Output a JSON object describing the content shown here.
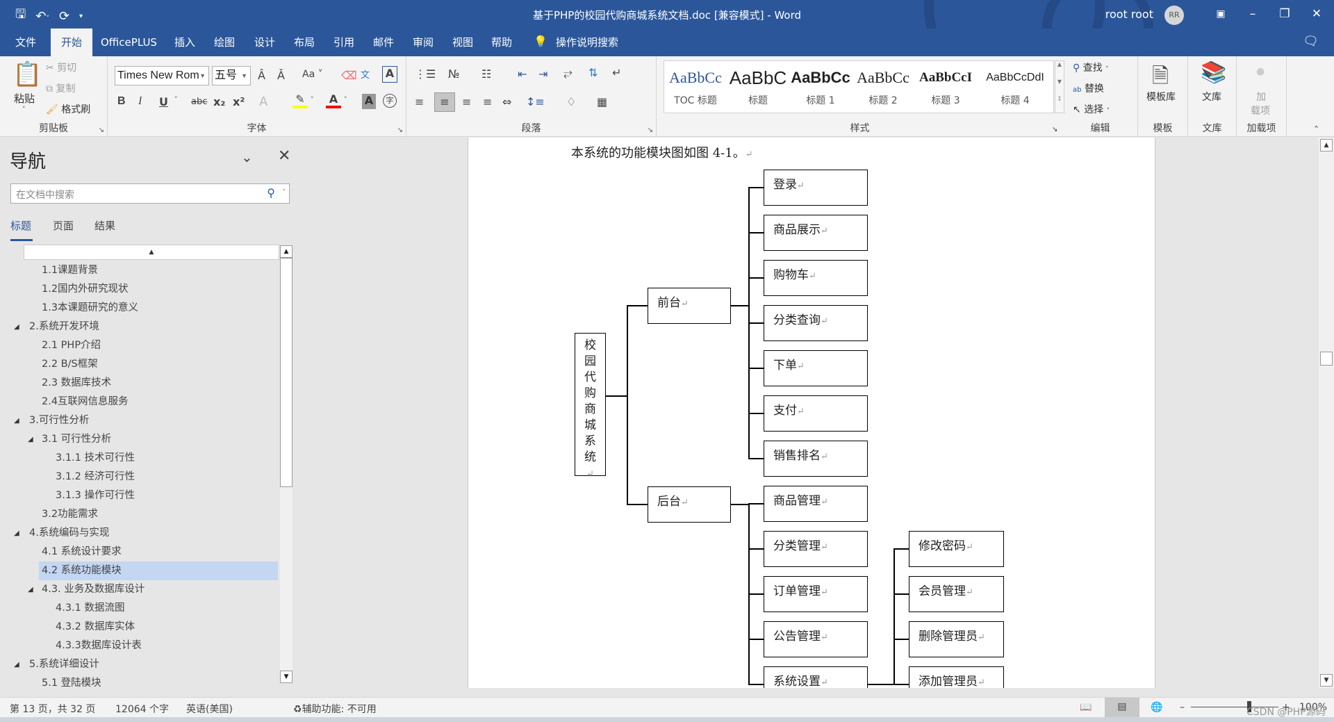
{
  "window": {
    "title": "基于PHP的校园代购商城系统文档.doc [兼容模式] - Word",
    "user_name": "root root",
    "user_initials": "RR",
    "quick_access": [
      "save-icon",
      "undo-icon",
      "redo-icon",
      "customize-qat-icon"
    ]
  },
  "tabs": [
    {
      "label": "文件",
      "active": false
    },
    {
      "label": "开始",
      "active": true
    },
    {
      "label": "OfficePLUS",
      "active": false
    },
    {
      "label": "插入",
      "active": false
    },
    {
      "label": "绘图",
      "active": false
    },
    {
      "label": "设计",
      "active": false
    },
    {
      "label": "布局",
      "active": false
    },
    {
      "label": "引用",
      "active": false
    },
    {
      "label": "邮件",
      "active": false
    },
    {
      "label": "审阅",
      "active": false
    },
    {
      "label": "视图",
      "active": false
    },
    {
      "label": "帮助",
      "active": false
    }
  ],
  "tell_me": "操作说明搜索",
  "ribbon": {
    "clipboard": {
      "label": "剪贴板",
      "paste": "粘贴",
      "cut": "剪切",
      "copy": "复制",
      "format_painter": "格式刷"
    },
    "font": {
      "label": "字体",
      "font_name": "Times New Rom",
      "font_size": "五号",
      "change_case": "Aa",
      "bold": "B",
      "italic": "I",
      "underline": "U",
      "strike": "abc",
      "subscript": "x₂",
      "superscript": "x²",
      "highlight_color": "#ffff00",
      "font_color": "#ff0000"
    },
    "paragraph": {
      "label": "段落"
    },
    "styles": {
      "label": "样式",
      "items": [
        {
          "preview": "AaBbCc",
          "name": "TOC 标题",
          "color": "#2f5597"
        },
        {
          "preview": "AaBbC",
          "name": "标题",
          "color": "#222"
        },
        {
          "preview": "AaBbCc",
          "name": "标题 1",
          "color": "#000"
        },
        {
          "preview": "AaBbCc",
          "name": "标题 2",
          "color": "#222"
        },
        {
          "preview": "AaBbCcI",
          "name": "标题 3",
          "color": "#000"
        },
        {
          "preview": "AaBbCcDdI",
          "name": "标题 4",
          "color": "#222"
        }
      ]
    },
    "editing": {
      "label": "编辑",
      "find": "查找",
      "replace": "替换",
      "select": "选择"
    },
    "template": {
      "label": "模板",
      "button": "模板库"
    },
    "library": {
      "label": "文库",
      "button": "文库"
    },
    "addins": {
      "label": "加载项",
      "button_line1": "加",
      "button_line2": "载项"
    }
  },
  "nav": {
    "title": "导航",
    "search_placeholder": "在文档中搜索",
    "tabs": [
      "标题",
      "页面",
      "结果"
    ],
    "active_tab": "标题",
    "headings": [
      {
        "text": "1.1课题背景",
        "level": 2,
        "toggle": false
      },
      {
        "text": "1.2国内外研究现状",
        "level": 2,
        "toggle": false
      },
      {
        "text": "1.3本课题研究的意义",
        "level": 2,
        "toggle": false
      },
      {
        "text": "2.系统开发环境",
        "level": 1,
        "toggle": true
      },
      {
        "text": "2.1 PHP介绍",
        "level": 2,
        "toggle": false
      },
      {
        "text": "2.2 B/S框架",
        "level": 2,
        "toggle": false
      },
      {
        "text": "2.3 数据库技术",
        "level": 2,
        "toggle": false
      },
      {
        "text": "2.4互联网信息服务",
        "level": 2,
        "toggle": false
      },
      {
        "text": "3.可行性分析",
        "level": 1,
        "toggle": true
      },
      {
        "text": "3.1 可行性分析",
        "level": 2,
        "toggle": true
      },
      {
        "text": "3.1.1 技术可行性",
        "level": 3,
        "toggle": false
      },
      {
        "text": "3.1.2 经济可行性",
        "level": 3,
        "toggle": false
      },
      {
        "text": "3.1.3 操作可行性",
        "level": 3,
        "toggle": false
      },
      {
        "text": "3.2功能需求",
        "level": 2,
        "toggle": false
      },
      {
        "text": "4.系统编码与实现",
        "level": 1,
        "toggle": true
      },
      {
        "text": "4.1 系统设计要求",
        "level": 2,
        "toggle": false
      },
      {
        "text": "4.2 系统功能模块",
        "level": 2,
        "toggle": false,
        "selected": true
      },
      {
        "text": "4.3. 业务及数据库设计",
        "level": 2,
        "toggle": true
      },
      {
        "text": "4.3.1 数据流图",
        "level": 3,
        "toggle": false
      },
      {
        "text": "4.3.2 数据库实体",
        "level": 3,
        "toggle": false
      },
      {
        "text": "4.3.3数据库设计表",
        "level": 3,
        "toggle": false
      },
      {
        "text": "5.系统详细设计",
        "level": 1,
        "toggle": true
      },
      {
        "text": "5.1 登陆模块",
        "level": 2,
        "toggle": false
      }
    ]
  },
  "document": {
    "intro": "本系统的功能模块图如图 4-1。",
    "para_mark": "↵",
    "diagram": {
      "root": "校园代购商城系统",
      "frontend": {
        "label": "前台",
        "children": [
          "登录",
          "商品展示",
          "购物车",
          "分类查询",
          "下单",
          "支付",
          "销售排名"
        ]
      },
      "backend": {
        "label": "后台",
        "children": [
          "商品管理",
          "分类管理",
          "订单管理",
          "公告管理",
          "系统设置"
        ]
      },
      "settings_children": [
        "修改密码",
        "会员管理",
        "删除管理员",
        "添加管理员"
      ]
    }
  },
  "status": {
    "page": "第 13 页，共 32 页",
    "words": "12064 个字",
    "language": "英语(美国)",
    "accessibility": "辅助功能: 不可用",
    "zoom": "100%",
    "zoom_fraction": 0.5,
    "watermark": "CSDN @PHP源码"
  }
}
